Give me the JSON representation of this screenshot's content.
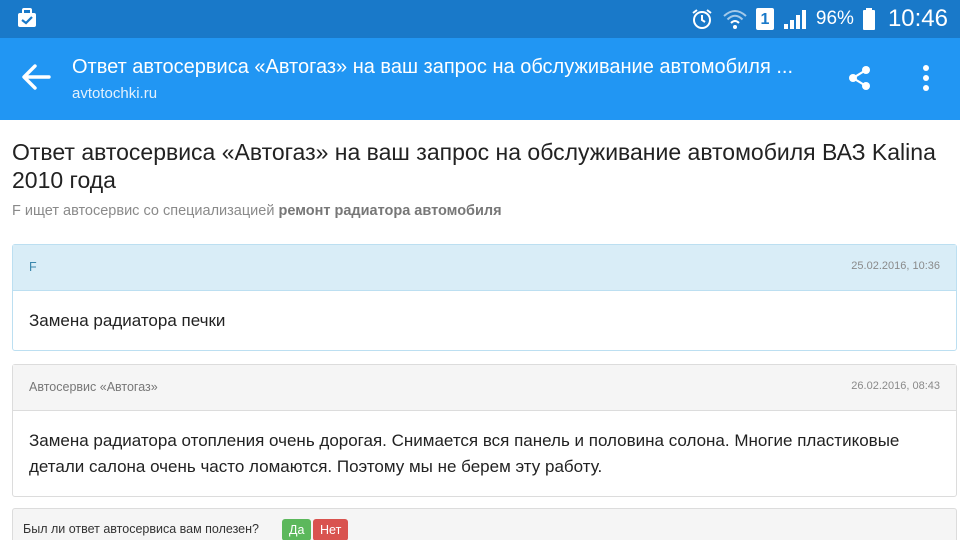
{
  "status_bar": {
    "battery_percent": "96%",
    "time": "10:46",
    "sim_slot": "1",
    "icons": [
      "briefcase-check-icon",
      "alarm-icon",
      "wifi-icon",
      "sim-icon",
      "signal-icon",
      "battery-icon"
    ]
  },
  "app_bar": {
    "title": "Ответ автосервиса «Автогаз» на ваш запрос на обслуживание автомобиля ...",
    "subtitle": "avtotochki.ru"
  },
  "page": {
    "heading": "Ответ автосервиса «Автогаз» на ваш запрос на обслуживание автомобиля ВАЗ Kalina 2010 года",
    "search_prefix": "F ищет автосервис со специализацией",
    "search_specialization": "ремонт радиатора автомобиля"
  },
  "messages": [
    {
      "author": "F",
      "date": "25.02.2016, 10:36",
      "text": "Замена радиатора печки"
    },
    {
      "author": "Автосервис «Автогаз»",
      "date": "26.02.2016, 08:43",
      "text": "Замена радиатора отопления очень дорогая. Снимается вся панель и половина солона. Многие пластиковые детали салона очень часто ломаются. Поэтому мы не берем эту работу."
    }
  ],
  "feedback": {
    "question": "Был ли ответ автосервиса вам полезен?",
    "yes_label": "Да",
    "no_label": "Нет"
  },
  "colors": {
    "status_bar": "#1979c9",
    "app_bar": "#2196f3",
    "user_header": "#d9edf7",
    "service_header": "#f5f5f5",
    "yes_button": "#5cb85c",
    "no_button": "#d9534f"
  }
}
